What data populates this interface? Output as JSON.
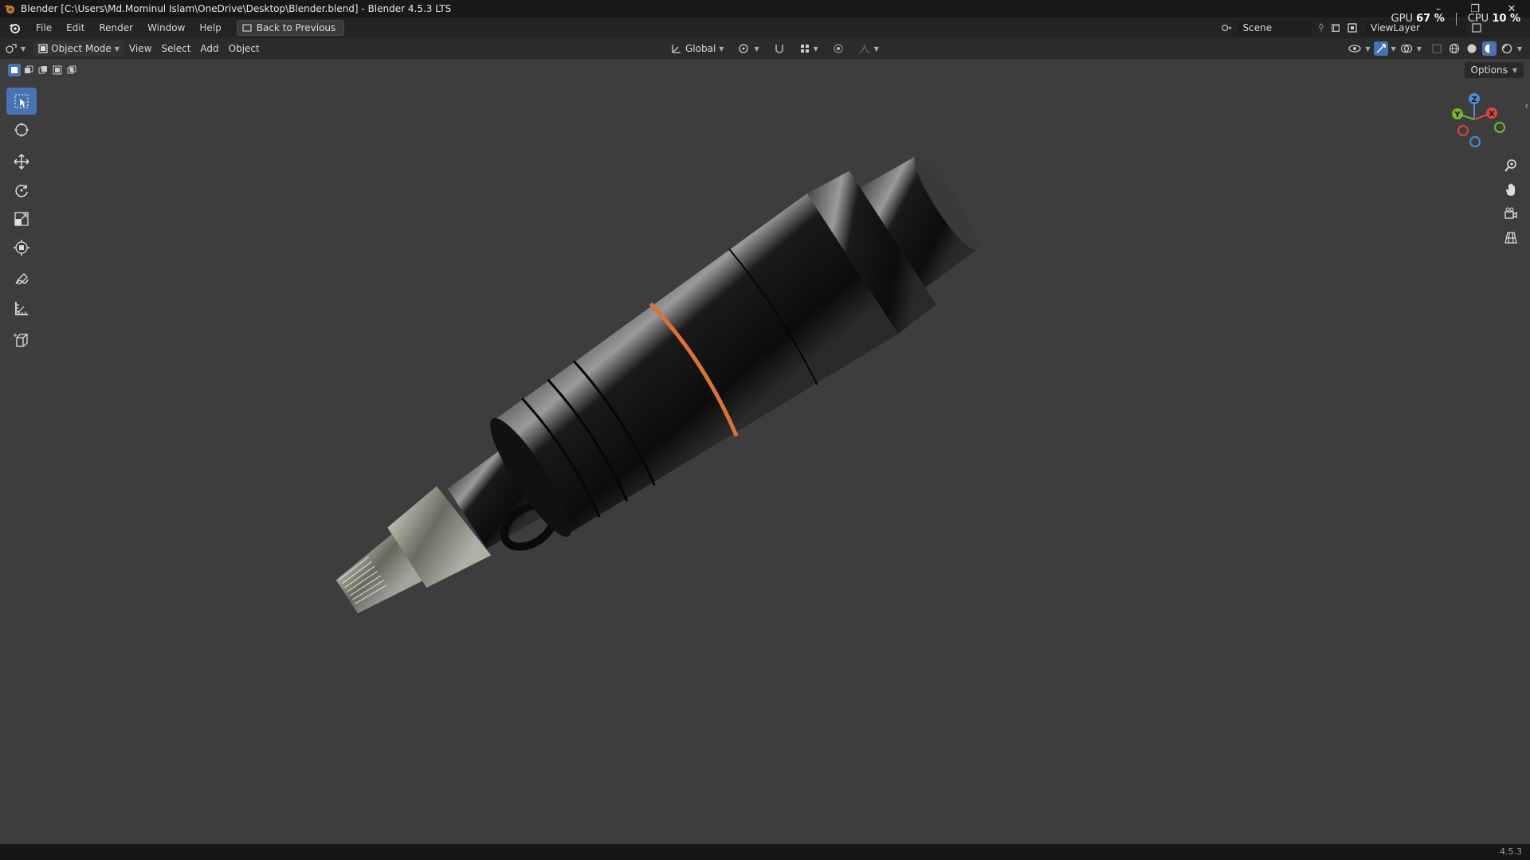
{
  "window": {
    "title": "Blender [C:\\Users\\Md.Mominul Islam\\OneDrive\\Desktop\\Blender.blend] - Blender 4.5.3 LTS",
    "controls": [
      "–",
      "❐",
      "✕"
    ]
  },
  "performance": {
    "gpu_label": "GPU",
    "gpu_value": "67 %",
    "cpu_label": "CPU",
    "cpu_value": "10 %"
  },
  "menubar": {
    "items": [
      "File",
      "Edit",
      "Render",
      "Window",
      "Help"
    ],
    "back_button": "Back to Previous",
    "scene": "Scene",
    "view_layer": "ViewLayer"
  },
  "header": {
    "mode": "Object Mode",
    "menus": [
      "View",
      "Select",
      "Add",
      "Object"
    ],
    "orientation": "Global"
  },
  "options_label": "Options",
  "toolbar": {
    "tools": [
      "select-box",
      "cursor",
      "move",
      "rotate",
      "scale",
      "transform",
      "annotate",
      "measure",
      "add-cube"
    ]
  },
  "gizmo": {
    "x": "X",
    "y": "Y",
    "z": "Z"
  },
  "status": {
    "version": "4.5.3"
  },
  "colors": {
    "accent": "#4772b3",
    "viewport_bg": "#3d3d3d",
    "copper": "#d8743a"
  }
}
